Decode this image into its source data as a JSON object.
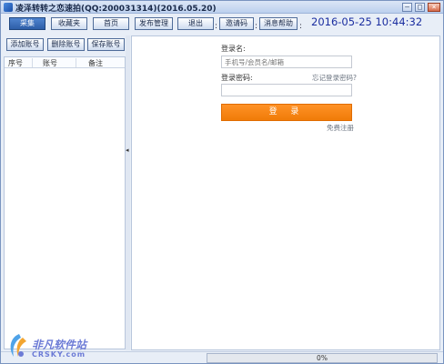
{
  "window": {
    "title": "凌泽转转之恋速拍(QQ:200031314)(2016.05.20)",
    "minimize_glyph": "–",
    "maximize_glyph": "□",
    "close_glyph": "×"
  },
  "toolbar": {
    "buttons": [
      "采集",
      "收藏夹",
      "首页",
      "发布管理",
      "退出",
      "邀请码",
      "消息帮助"
    ],
    "active_index": 0,
    "separators": [
      ":",
      ":",
      ":"
    ],
    "clock": "2016-05-25 10:44:32"
  },
  "accounts": {
    "buttons": [
      "添加账号",
      "删除账号",
      "保存账号"
    ],
    "columns": [
      "序号",
      "账号",
      "备注"
    ]
  },
  "splitter": {
    "arrow": "◂"
  },
  "login": {
    "username_label": "登录名:",
    "username_placeholder": "手机号/会员名/邮箱",
    "password_label": "登录密码:",
    "forgot_link": "忘记登录密码?",
    "password_placeholder": "",
    "submit_label": "登 录",
    "register_link": "免费注册"
  },
  "status": {
    "progress_percent": 0,
    "progress_text": "0%"
  },
  "watermark": {
    "name": "非凡软件站",
    "site": "CRSKY.com"
  },
  "colors": {
    "accent": "#f07b08",
    "clock": "#1b2ea0",
    "active_button": "#2d5ea8"
  }
}
